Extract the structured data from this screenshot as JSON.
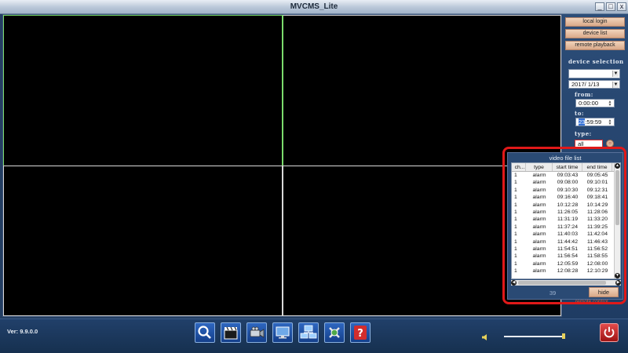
{
  "window": {
    "title": "MVCMS_Lite",
    "min_symbol": "_",
    "max_symbol": "□",
    "close_symbol": "x"
  },
  "right_panel": {
    "buttons": {
      "local_login": "local login",
      "device_list": "device list",
      "remote_playback": "remote playback"
    },
    "device_selection_label": "device selection",
    "date_value": "2017/  1/13",
    "from_label": "from:",
    "from_value": "0:00:00",
    "to_label": "to:",
    "to_value_hour": "23",
    "to_value_rest": ":59:59",
    "type_label": "type:",
    "type_value": "all"
  },
  "file_list": {
    "title": "video file list",
    "columns": [
      "ch...",
      "type",
      "start time",
      "end time"
    ],
    "rows": [
      {
        "ch": "1",
        "type": "alarm",
        "start": "09:03:43",
        "end": "09:05:45"
      },
      {
        "ch": "1",
        "type": "alarm",
        "start": "09:08:00",
        "end": "09:10:01"
      },
      {
        "ch": "1",
        "type": "alarm",
        "start": "09:10:30",
        "end": "09:12:31"
      },
      {
        "ch": "1",
        "type": "alarm",
        "start": "09:16:40",
        "end": "09:18:41"
      },
      {
        "ch": "1",
        "type": "alarm",
        "start": "10:12:28",
        "end": "10:14:29"
      },
      {
        "ch": "1",
        "type": "alarm",
        "start": "11:26:05",
        "end": "11:28:06"
      },
      {
        "ch": "1",
        "type": "alarm",
        "start": "11:31:19",
        "end": "11:33:20"
      },
      {
        "ch": "1",
        "type": "alarm",
        "start": "11:37:24",
        "end": "11:39:25"
      },
      {
        "ch": "1",
        "type": "alarm",
        "start": "11:40:03",
        "end": "11:42:04"
      },
      {
        "ch": "1",
        "type": "alarm",
        "start": "11:44:42",
        "end": "11:46:43"
      },
      {
        "ch": "1",
        "type": "alarm",
        "start": "11:54:51",
        "end": "11:56:52"
      },
      {
        "ch": "1",
        "type": "alarm",
        "start": "11:56:54",
        "end": "11:58:55"
      },
      {
        "ch": "1",
        "type": "alarm",
        "start": "12:05:59",
        "end": "12:08:00"
      },
      {
        "ch": "1",
        "type": "alarm",
        "start": "12:08:28",
        "end": "12:10:29"
      }
    ],
    "count": "39",
    "hide_label": "hide",
    "remote_control_label": "remote control"
  },
  "bottom": {
    "version": "Ver: 9.9.0.0",
    "tools": [
      "search-icon",
      "clapperboard-icon",
      "camera-icon",
      "monitor-icon",
      "network-icon",
      "settings-icon",
      "help-icon"
    ],
    "volume_level": 1.0
  },
  "colors": {
    "active_cell": "#7bdc6c",
    "highlight": "#e01919",
    "button": "#d9a989"
  }
}
